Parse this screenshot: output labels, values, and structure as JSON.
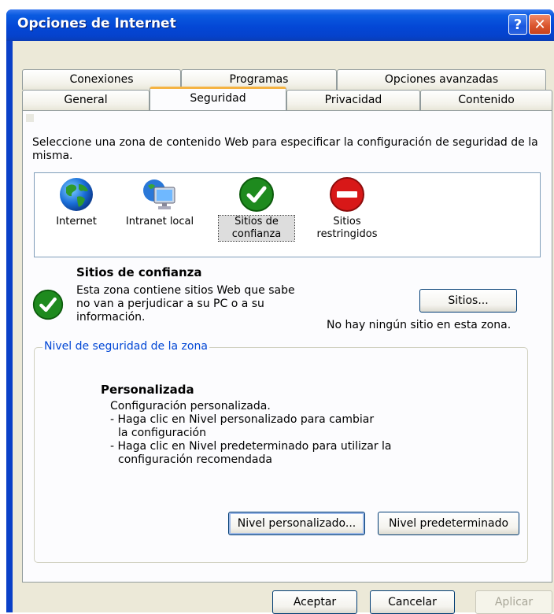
{
  "window": {
    "title": "Opciones de Internet",
    "help_label": "?",
    "close_label": "✕"
  },
  "tabs": {
    "row1": [
      "Conexiones",
      "Programas",
      "Opciones avanzadas"
    ],
    "row2": [
      "General",
      "Seguridad",
      "Privacidad",
      "Contenido"
    ],
    "active": "Seguridad"
  },
  "security": {
    "instruction": "Seleccione una zona de contenido Web para especificar la configuración de seguridad de la misma.",
    "zones": [
      {
        "label": "Internet",
        "icon": "globe-icon"
      },
      {
        "label": "Intranet local",
        "icon": "monitor-icon"
      },
      {
        "label": "Sitios de confianza",
        "icon": "green-check-icon",
        "selected": true
      },
      {
        "label": "Sitios restringidos",
        "icon": "red-no-entry-icon"
      }
    ],
    "selected_zone": {
      "title": "Sitios de confianza",
      "description": "Esta zona contiene sitios Web que sabe no van a perjudicar a su PC o a su información.",
      "sites_button": "Sitios...",
      "no_sites_text": "No hay ningún sitio en esta zona."
    },
    "level_group": {
      "legend": "Nivel de seguridad de la zona",
      "level_title": "Personalizada",
      "lines": [
        "Configuración personalizada.",
        "- Haga clic en Nivel personalizado para cambiar",
        "  la configuración",
        "- Haga clic en Nivel predeterminado para utilizar la",
        "  configuración recomendada"
      ],
      "custom_button": "Nivel personalizado...",
      "default_button": "Nivel predeterminado"
    }
  },
  "footer": {
    "ok": "Aceptar",
    "cancel": "Cancelar",
    "apply": "Aplicar"
  },
  "colors": {
    "title_bar": "#0a5be0",
    "active_tab_accent": "#f5b342",
    "legend_text": "#0046d5"
  }
}
